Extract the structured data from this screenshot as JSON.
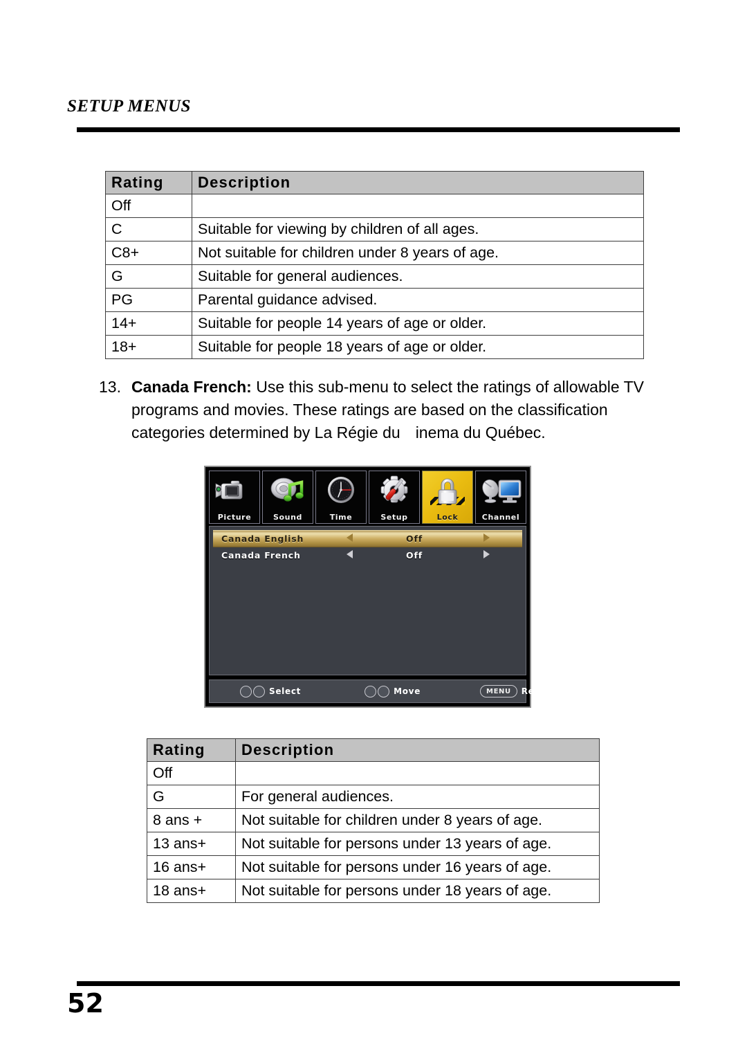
{
  "header": {
    "title": "SETUP MENUS"
  },
  "table_one": {
    "columns": [
      "Rating",
      "Description"
    ],
    "rows": [
      [
        "Off",
        ""
      ],
      [
        "C",
        "Suitable for viewing by children of all ages."
      ],
      [
        "C8+",
        "Not suitable for children under 8 years of age."
      ],
      [
        "G",
        "Suitable for general audiences."
      ],
      [
        "PG",
        "Parental guidance advised."
      ],
      [
        "14+",
        "Suitable for people 14 years of age or older."
      ],
      [
        "18+",
        "Suitable for people 18 years of age or older."
      ]
    ]
  },
  "paragraph": {
    "number": "13.",
    "term": "Canada French:",
    "text_part_1": " Use this sub-menu to select the ratings of allowable TV programs and movies. These ratings are based on the classification categories determined by La Régie du",
    "text_part_2": "inema du Québec."
  },
  "osd": {
    "icons": [
      {
        "label": "Picture",
        "icon": "camcorder-icon",
        "active": false
      },
      {
        "label": "Sound",
        "icon": "speaker-music-note-icon",
        "active": false
      },
      {
        "label": "Time",
        "icon": "clock-icon",
        "active": false
      },
      {
        "label": "Setup",
        "icon": "gear-screwdriver-icon",
        "active": false
      },
      {
        "label": "Lock",
        "icon": "padlock-icon",
        "active": true
      },
      {
        "label": "Channel",
        "icon": "satellite-dish-tv-icon",
        "active": false
      }
    ],
    "menu_rows": [
      {
        "label": "Canada English",
        "value": "Off",
        "selected": true
      },
      {
        "label": "Canada French",
        "value": "Off",
        "selected": false
      }
    ],
    "footer_hints": [
      {
        "keys": "up-down-arrow-keys",
        "label": "Select"
      },
      {
        "keys": "left-right-arrow-keys",
        "label": "Move"
      },
      {
        "keys": "MENU",
        "label": "Return"
      }
    ],
    "colors": {
      "highlight": "#cdae63",
      "active_tab": "#e9bb10",
      "panel": "#3b3e45"
    }
  },
  "table_two": {
    "columns": [
      "Rating",
      "Description"
    ],
    "rows": [
      [
        "Off",
        ""
      ],
      [
        "G",
        "For general audiences."
      ],
      [
        "8 ans +",
        "Not suitable for children under 8 years of age."
      ],
      [
        "13 ans+",
        "Not suitable for persons under 13 years of age."
      ],
      [
        "16 ans+",
        "Not suitable for persons under 16 years of age."
      ],
      [
        "18 ans+",
        "Not suitable for persons under 18 years of age."
      ]
    ]
  },
  "footer": {
    "page_number": "52"
  }
}
